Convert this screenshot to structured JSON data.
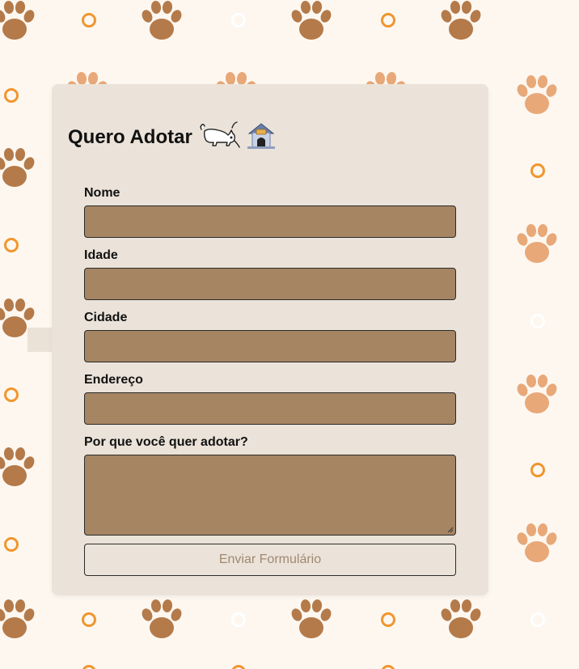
{
  "form": {
    "title": "Quero Adotar",
    "title_emoji_1": "cat-icon",
    "title_emoji_2": "dog-house-icon",
    "fields": [
      {
        "label": "Nome",
        "value": ""
      },
      {
        "label": "Idade",
        "value": ""
      },
      {
        "label": "Cidade",
        "value": ""
      },
      {
        "label": "Endereço",
        "value": ""
      }
    ],
    "reason_label": "Por que você quer adotar?",
    "reason_value": "",
    "submit_label": "Enviar Formulário"
  },
  "colors": {
    "page_background": "#fdf7f0",
    "card_background": "#ebe3d9",
    "input_fill": "#a68563",
    "paw_dark": "#b47a4a",
    "paw_light": "#e8a878",
    "ring_orange": "#f0962e",
    "submit_text": "#a08870"
  }
}
